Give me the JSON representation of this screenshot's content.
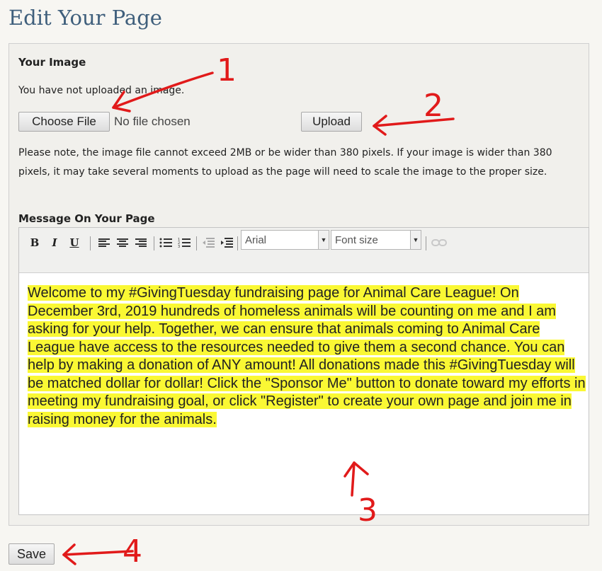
{
  "page": {
    "title": "Edit Your Page"
  },
  "image_section": {
    "heading": "Your Image",
    "status": "You have not uploaded an image.",
    "choose_file_label": "Choose File",
    "no_file_text": "No file chosen",
    "upload_label": "Upload",
    "note": "Please note, the image file cannot exceed 2MB or be wider than 380 pixels. If your image is wider than 380 pixels, it may take several moments to upload as the page will need to scale the image to the proper size."
  },
  "message_section": {
    "heading": "Message On Your Page",
    "toolbar": {
      "bold": "B",
      "italic": "I",
      "underline": "U",
      "font_family": "Arial",
      "font_size": "Font size"
    },
    "content": "Welcome to my #GivingTuesday fundraising page for Animal Care League! On December 3rd, 2019 hundreds of homeless animals will be counting on me and I am asking for your help.  Together, we can ensure that animals coming to Animal Care League have access to the resources needed to give them a second chance.  You can help by making a donation of ANY amount!  All donations made this #GivingTuesday will be matched dollar for dollar!  Click the \"Sponsor Me\" button to donate toward my efforts in meeting my fundraising goal, or click \"Register\" to create your own page and join me in raising money for the animals."
  },
  "save_label": "Save",
  "annotations": {
    "n1": "1",
    "n2": "2",
    "n3": "3",
    "n4": "4"
  },
  "colors": {
    "highlight": "#faf834",
    "annotation": "#e11a1a",
    "title": "#3f5f7c"
  }
}
